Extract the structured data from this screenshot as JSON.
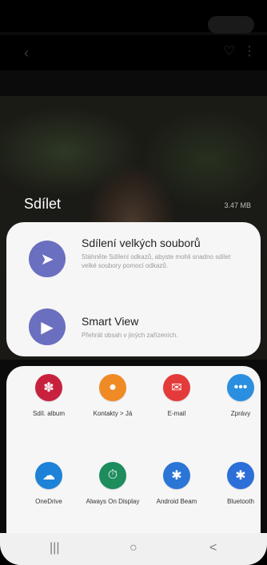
{
  "share": {
    "title": "Sdílet",
    "size": "3.47 MB"
  },
  "big_files": {
    "title": "Sdílení velkých souborů",
    "subtitle": "Stáhněte Sdílení odkazů, abyste mohli snadno sdílet velké soubory pomocí odkazů."
  },
  "smart_view": {
    "title": "Smart View",
    "subtitle": "Přehrát obsah v jiných zařízeních."
  },
  "apps": [
    {
      "label": "Sdíl. album",
      "color": "#c8213e",
      "icon": "flower-icon"
    },
    {
      "label": "Kontakty > Já",
      "color": "#f08a24",
      "icon": "person-icon"
    },
    {
      "label": "E-mail",
      "color": "#e53a3a",
      "icon": "mail-icon"
    },
    {
      "label": "Zprávy",
      "color": "#2a8fe0",
      "icon": "chat-icon"
    },
    {
      "label": "OneDrive",
      "color": "#1d82d8",
      "icon": "cloud-icon"
    },
    {
      "label": "Always On Display",
      "color": "#1e8c5d",
      "icon": "clock-icon"
    },
    {
      "label": "Android Beam",
      "color": "#2b75d6",
      "icon": "bluetooth-icon"
    },
    {
      "label": "Bluetooth",
      "color": "#2c6fd8",
      "icon": "bluetooth-icon"
    }
  ],
  "nav": {
    "recent": "|||",
    "home": "○",
    "back": "<"
  }
}
